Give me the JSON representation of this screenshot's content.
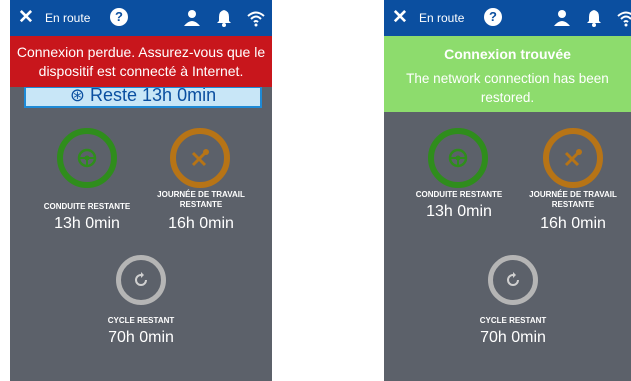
{
  "header": {
    "close_icon": "close-icon",
    "title": "En route",
    "help_label": "?",
    "user_icon": "user-icon",
    "bell_icon": "bell-icon",
    "wifi_icon": "wifi-icon"
  },
  "left": {
    "banner_message": "Connexion perdue. Assurez-vous que le dispositif est connecté à Internet.",
    "remaining_button": "Reste 13h 0min",
    "driving": {
      "label": "CONDUITE RESTANTE",
      "value": "13h 0min",
      "color": "#2f8d1c"
    },
    "workday": {
      "label": "JOURNÉE DE TRAVAIL RESTANTE",
      "value": "16h 0min",
      "color": "#b77416"
    },
    "cycle": {
      "label": "CYCLE RESTANT",
      "value": "70h 0min",
      "color": "#b5b5b5"
    }
  },
  "right": {
    "banner_title": "Connexion trouvée",
    "banner_message": "The network connection has been restored.",
    "driving": {
      "label": "CONDUITE RESTANTE",
      "value": "13h 0min"
    },
    "workday": {
      "label": "JOURNÉE DE TRAVAIL RESTANTE",
      "value": "16h 0min"
    },
    "cycle": {
      "label": "CYCLE RESTANT",
      "value": "70h 0min"
    }
  },
  "colors": {
    "topbar": "#0b4fa0",
    "error": "#c8161c",
    "success": "#8ddc6d",
    "panel": "#5c616a"
  }
}
